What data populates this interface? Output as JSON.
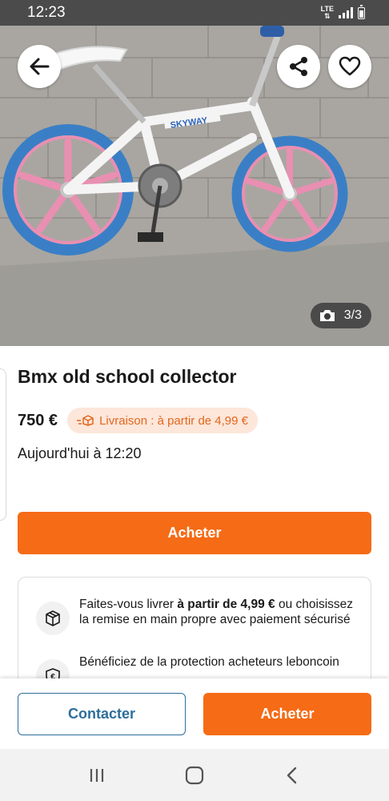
{
  "status_bar": {
    "time": "12:23",
    "network": "LTE",
    "icons": [
      "lte-icon",
      "signal-icon",
      "battery-icon"
    ]
  },
  "gallery": {
    "counter": "3/3",
    "icons": [
      "back-arrow-icon",
      "share-icon",
      "heart-icon",
      "camera-icon"
    ]
  },
  "listing": {
    "title": "Bmx old school collector",
    "price": "750 €",
    "delivery_badge": "Livraison : à partir de 4,99 €",
    "date": "Aujourd'hui à 12:20"
  },
  "buy_button_label": "Acheter",
  "info_card": {
    "delivery_prefix": "Faites-vous livrer ",
    "delivery_bold": "à partir de 4,99 €",
    "delivery_suffix": " ou choisissez la remise en main propre avec paiement sécurisé",
    "protection_text": "Bénéficiez de la protection acheteurs leboncoin"
  },
  "action_bar": {
    "contact_label": "Contacter",
    "buy_label": "Acheter"
  },
  "system_nav": {
    "icons": [
      "recent-apps-icon",
      "home-icon",
      "back-icon"
    ]
  },
  "colors": {
    "accent_orange": "#f56b16",
    "badge_bg": "#fde6da",
    "badge_text": "#e1671b",
    "contact_blue": "#2d6e9c",
    "status_bar": "#4b4b4b"
  }
}
